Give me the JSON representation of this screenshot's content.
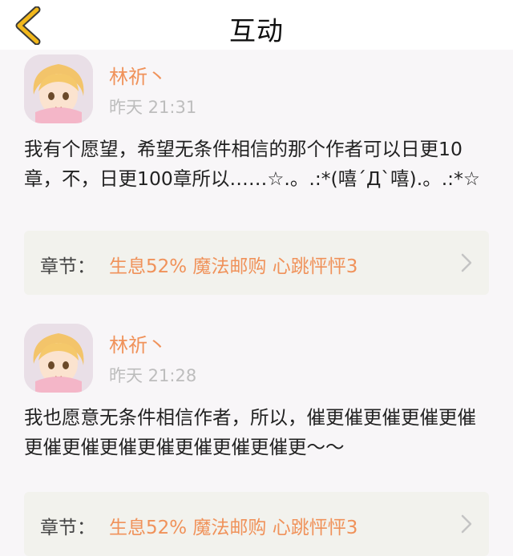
{
  "header": {
    "title": "互动",
    "back_icon": "chevron-left-icon",
    "accent_color": "#f2b81c"
  },
  "posts": [
    {
      "username": "林祈丶",
      "time": "昨天 21:31",
      "content": "我有个愿望，希望无条件相信的那个作者可以日更10章，不，日更100章所以……☆.。.:*(嘻´Д`嘻).。.:*☆",
      "chapter_label": "章节：",
      "chapter_title": "生息52% 魔法邮购 心跳怦怦3"
    },
    {
      "username": "林祈丶",
      "time": "昨天 21:28",
      "content": "我也愿意无条件相信作者，所以，催更催更催更催更催更催更催更催更催更催更催更催更～～",
      "chapter_label": "章节：",
      "chapter_title": "生息52% 魔法邮购 心跳怦怦3"
    }
  ],
  "colors": {
    "username": "#f0925a",
    "chapter_title": "#f0925a",
    "timestamp": "#bdbdbd",
    "chapter_background": "#f2f2ed"
  }
}
